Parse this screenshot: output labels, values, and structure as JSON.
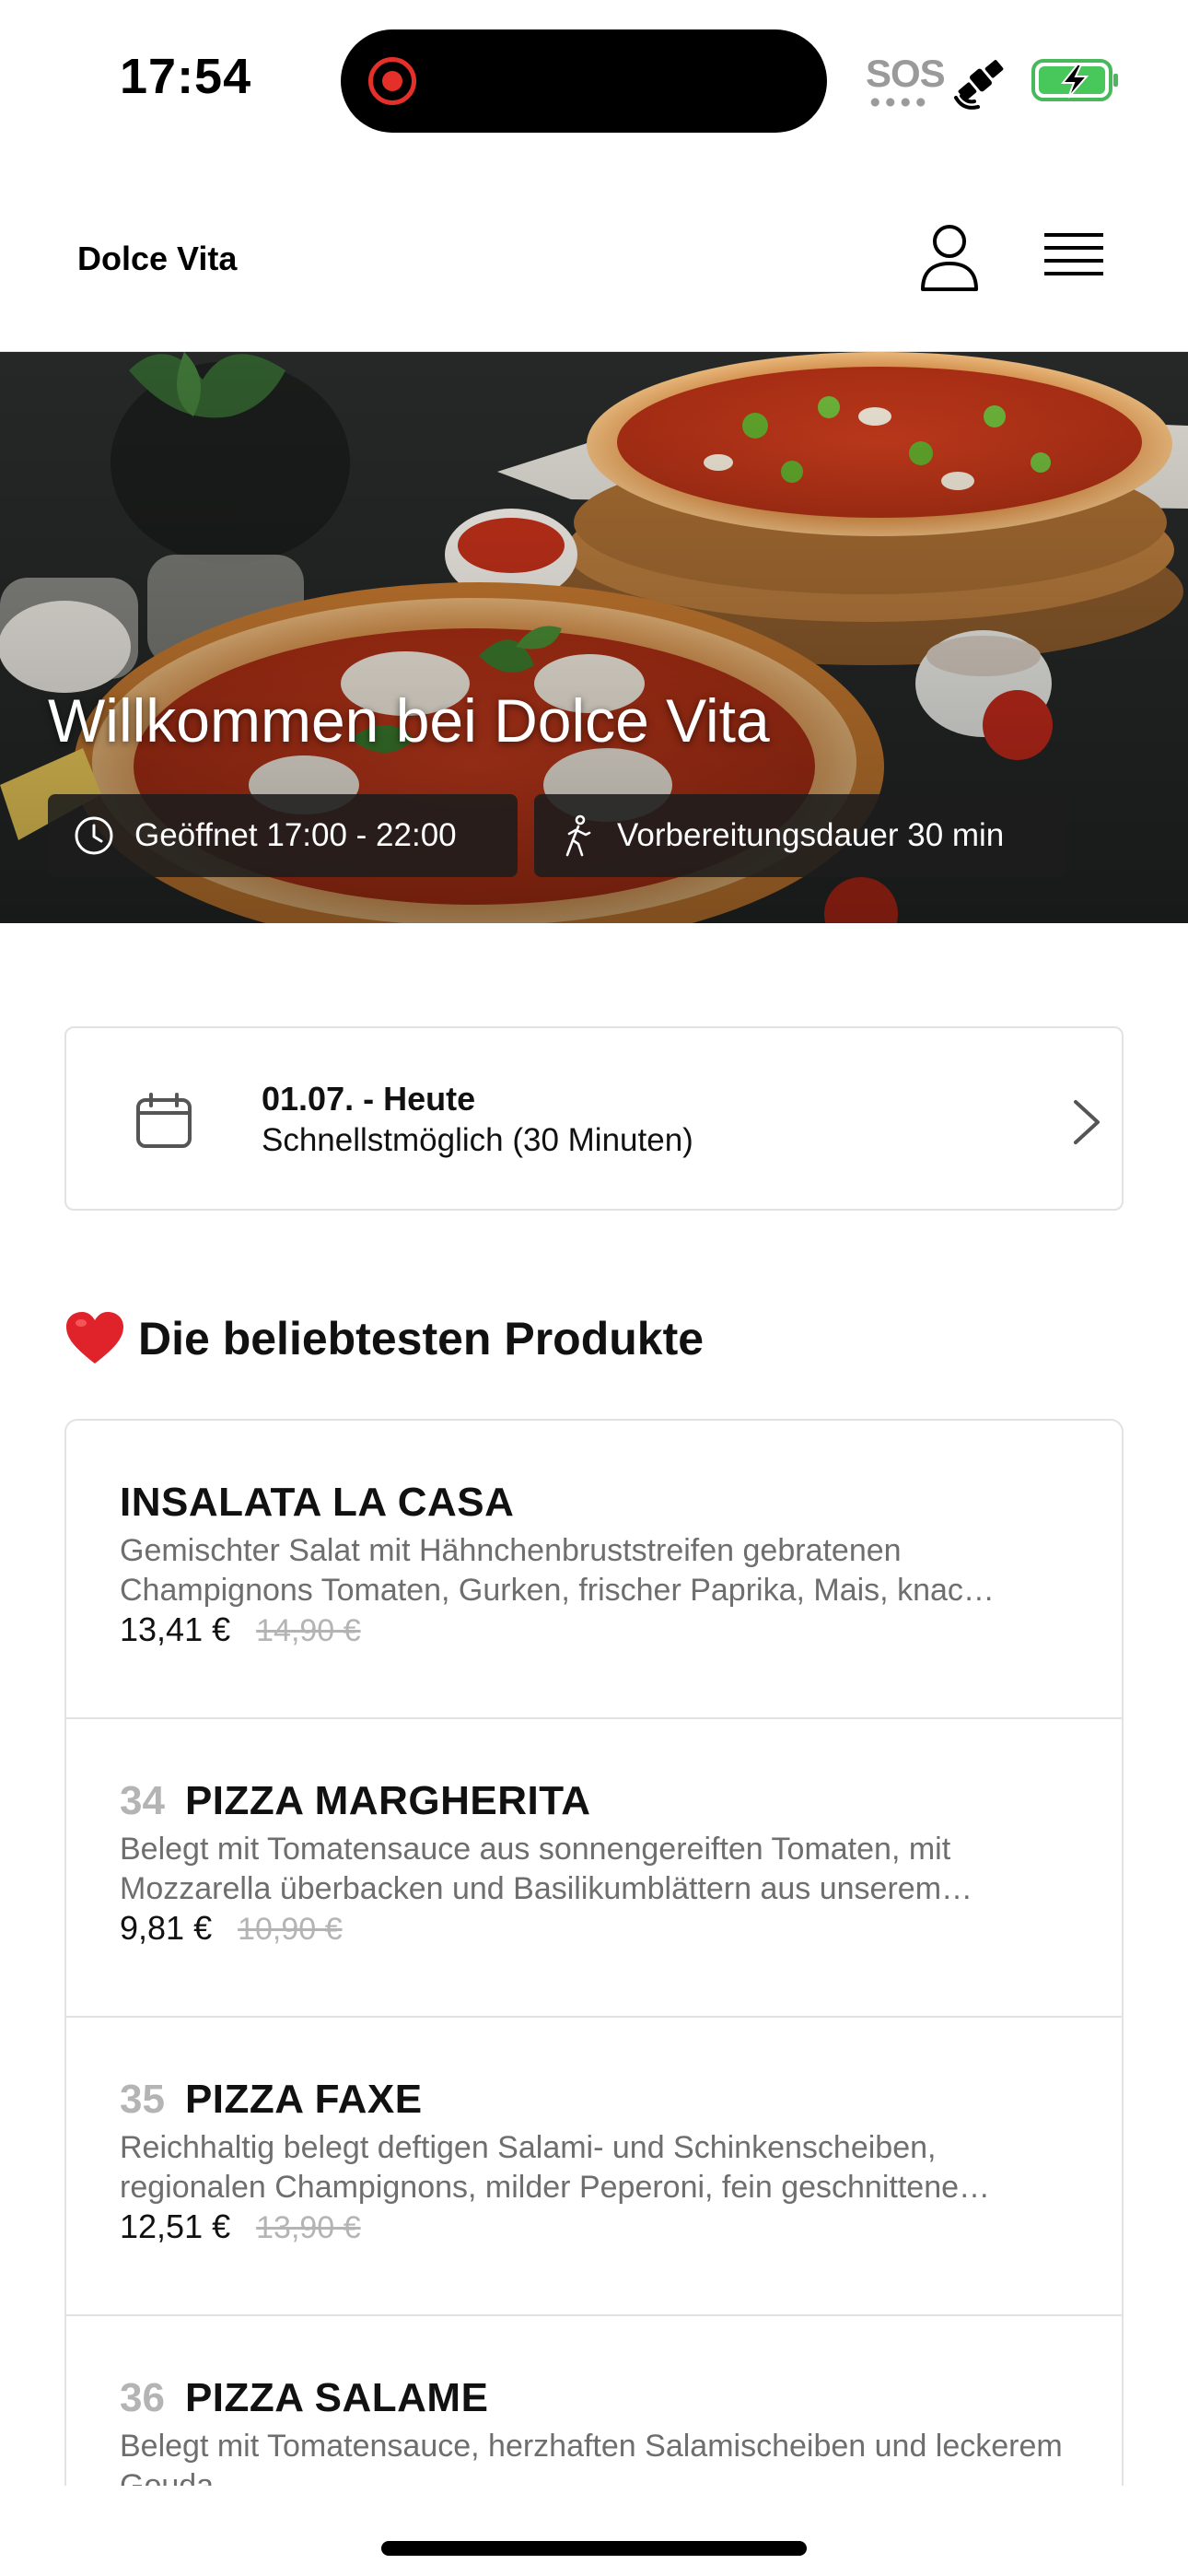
{
  "status_bar": {
    "time": "17:54",
    "sos_label": "SOS",
    "icons": [
      "screen-recording-icon",
      "satellite-icon",
      "battery-charging-icon"
    ]
  },
  "header": {
    "brand": "Dolce Vita",
    "icons": [
      "user-icon",
      "menu-icon"
    ]
  },
  "hero": {
    "title": "Willkommen bei Dolce Vita",
    "opening_hours": "Geöffnet 17:00 - 22:00",
    "preparation_time": "Vorbereitungsdauer 30 min"
  },
  "date_selector": {
    "date": "01.07. - Heute",
    "time_option": "Schnellstmöglich (30 Minuten)"
  },
  "popular": {
    "emoji": "❤️",
    "title": "Die beliebtesten Produkte",
    "products": [
      {
        "number": "",
        "name": "INSALATA LA CASA",
        "description": "Gemischter Salat mit Hähnchenbruststreifen gebratenen Champignons Tomaten, Gurken, frischer Paprika, Mais, knac…",
        "price": "13,41 €",
        "old_price": "14,90 €"
      },
      {
        "number": "34",
        "name": "PIZZA MARGHERITA",
        "description": "Belegt mit Tomatensauce aus sonnengereiften Tomaten, mit Mozzarella überbacken und Basilikumblättern aus unserem…",
        "price": "9,81 €",
        "old_price": "10,90 €"
      },
      {
        "number": "35",
        "name": "PIZZA FAXE",
        "description": "Reichhaltig belegt deftigen Salami- und Schinkenscheiben, regionalen Champignons, milder Peperoni, fein geschnittene…",
        "price": "12,51 €",
        "old_price": "13,90 €"
      },
      {
        "number": "36",
        "name": "PIZZA SALAME",
        "description": "Belegt mit Tomatensauce, herzhaften Salamischeiben und leckerem Gouda",
        "price": "",
        "old_price": ""
      }
    ]
  }
}
